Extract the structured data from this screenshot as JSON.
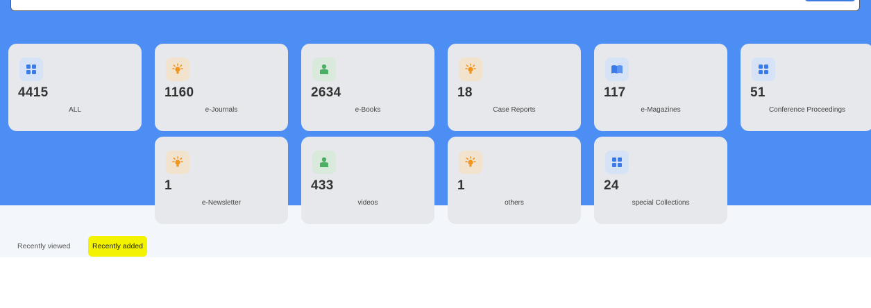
{
  "colors": {
    "hero": "#4d8ef5",
    "card": "#e6e8eb",
    "highlight": "#f3f300"
  },
  "categories": [
    {
      "count": "4415",
      "label": "ALL",
      "icon": "grid-icon"
    },
    {
      "count": "1160",
      "label": "e-Journals",
      "icon": "bulb-icon"
    },
    {
      "count": "2634",
      "label": "e-Books",
      "icon": "reader-icon"
    },
    {
      "count": "18",
      "label": "Case Reports",
      "icon": "bulb-icon"
    },
    {
      "count": "117",
      "label": "e-Magazines",
      "icon": "book-icon"
    },
    {
      "count": "51",
      "label": "Conference Proceedings",
      "icon": "grid-icon"
    },
    {
      "count": "1",
      "label": "e-Newsletter",
      "icon": "bulb-icon"
    },
    {
      "count": "433",
      "label": "videos",
      "icon": "reader-icon"
    },
    {
      "count": "1",
      "label": "others",
      "icon": "bulb-icon"
    },
    {
      "count": "24",
      "label": "special Collections",
      "icon": "grid-icon"
    }
  ],
  "tabs": {
    "recently_viewed": "Recently viewed",
    "recently_added": "Recently added"
  }
}
